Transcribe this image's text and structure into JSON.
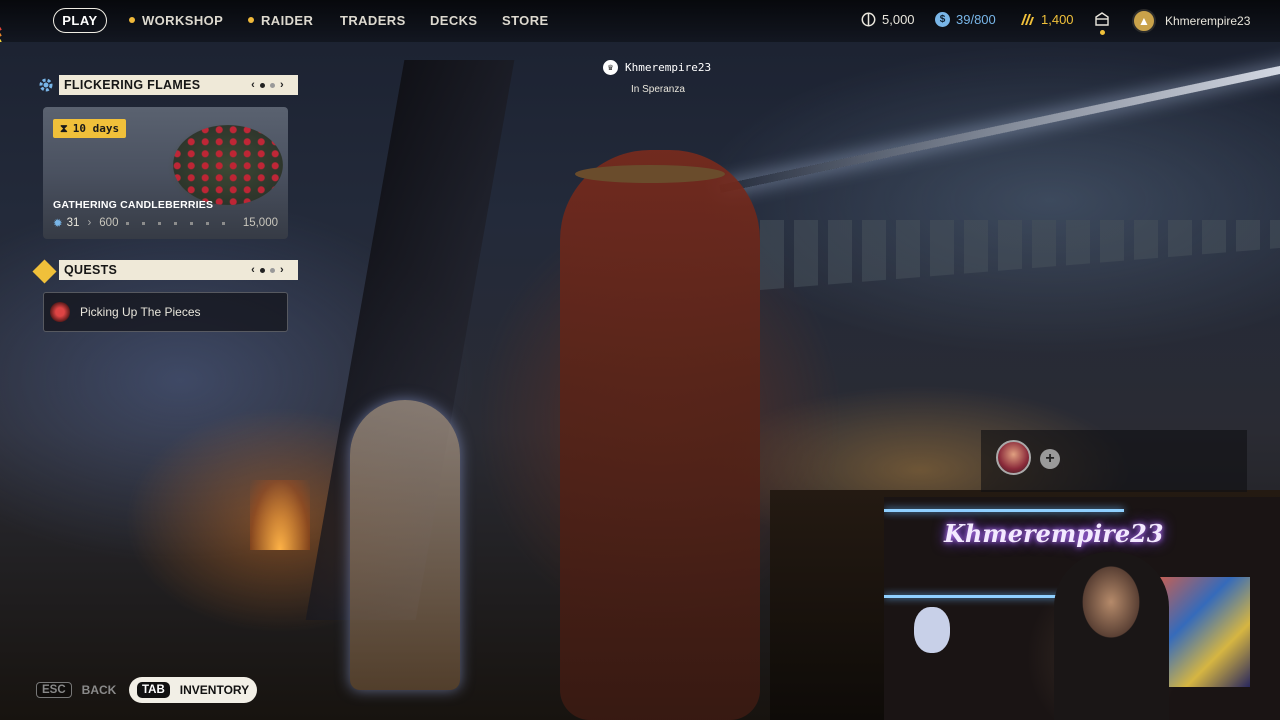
{
  "nav": {
    "play": "PLAY",
    "items": [
      {
        "label": "WORKSHOP",
        "dot": true
      },
      {
        "label": "RAIDER",
        "dot": true
      },
      {
        "label": "TRADERS",
        "dot": false
      },
      {
        "label": "DECKS",
        "dot": false
      },
      {
        "label": "STORE",
        "dot": false
      }
    ]
  },
  "currencies": {
    "coins": "5,000",
    "capacity": "39/800",
    "credits": "1,400"
  },
  "profile": {
    "username": "Khmerempire23"
  },
  "event": {
    "title": "FLICKERING FLAMES",
    "timer": "10 days",
    "name": "GATHERING CANDLEBERRIES",
    "current": "31",
    "next_threshold": "600",
    "max": "15,000",
    "progress": 0.002
  },
  "quests": {
    "title": "QUESTS",
    "items": [
      {
        "label": "Picking Up The Pieces"
      }
    ]
  },
  "player": {
    "name": "Khmerempire23",
    "location": "In Speranza"
  },
  "stream": {
    "sign_text": "Khmerempire23"
  },
  "hints": {
    "back_key": "ESC",
    "back_label": "BACK",
    "inventory_key": "TAB",
    "inventory_label": "INVENTORY"
  },
  "colors": {
    "accent": "#f0c03a",
    "panel_header_bg": "#efe9d8",
    "credits_color": "#f0c03a",
    "capacity_color": "#79b6e8"
  }
}
